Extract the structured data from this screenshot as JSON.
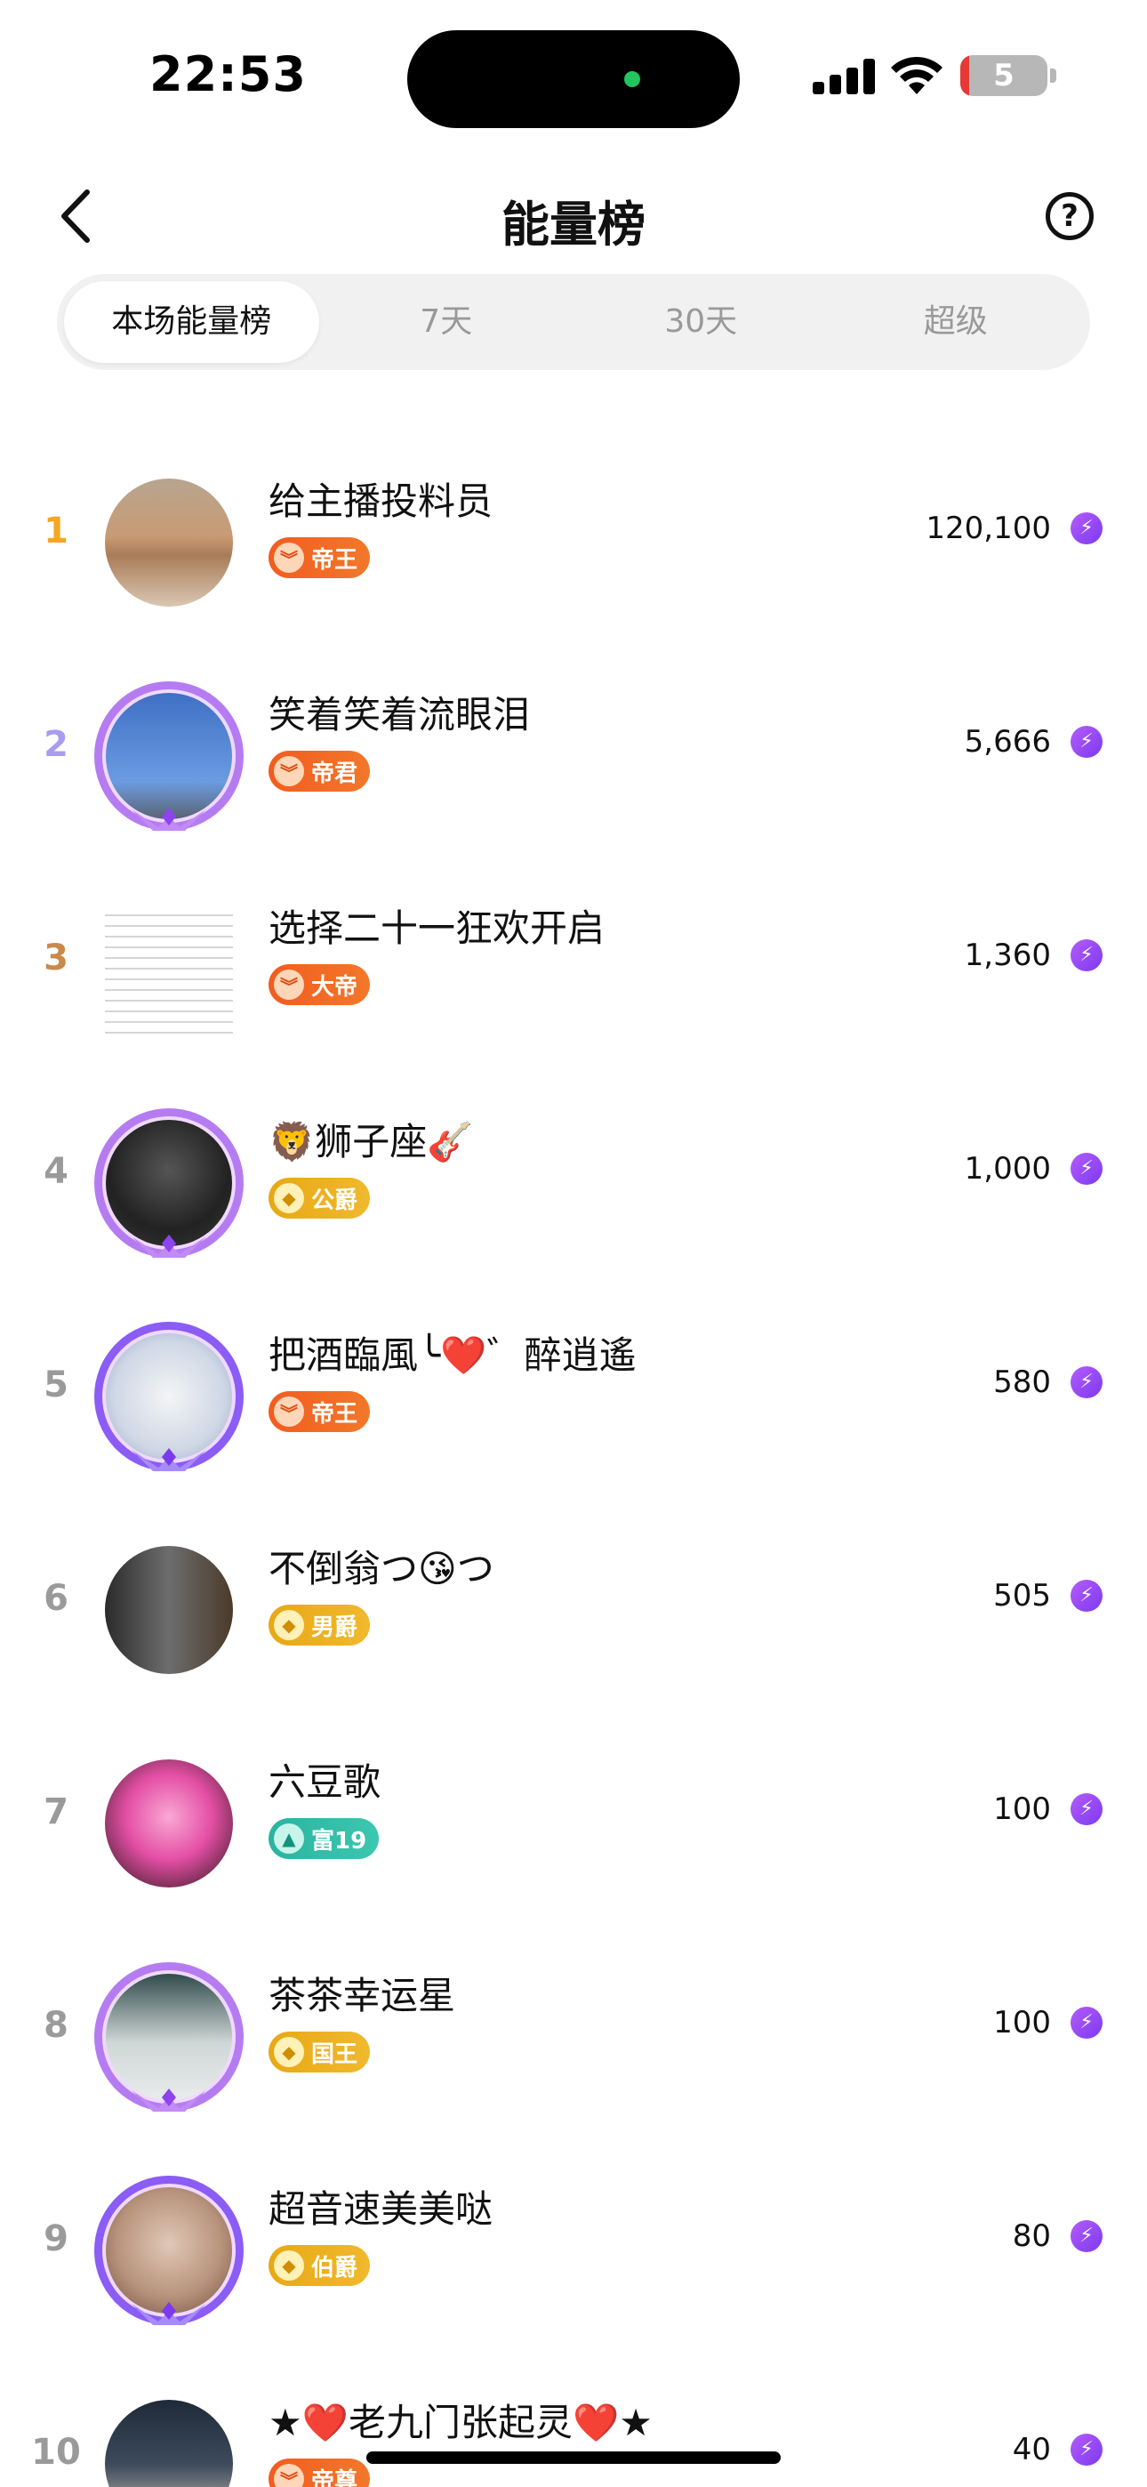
{
  "status_bar": {
    "time": "22:53",
    "battery": "5"
  },
  "header": {
    "title": "能量榜",
    "help_symbol": "?"
  },
  "tabs": [
    {
      "label": "本场能量榜",
      "active": true
    },
    {
      "label": "7天",
      "active": false
    },
    {
      "label": "30天",
      "active": false
    },
    {
      "label": "超级",
      "active": false
    }
  ],
  "rows": [
    {
      "rank": "1",
      "name": "给主播投料员",
      "badge": "帝王",
      "badge_icon": "crown-chevron-icon",
      "score": "120,100"
    },
    {
      "rank": "2",
      "name": "笑着笑着流眼泪",
      "badge": "帝君",
      "badge_icon": "crown-chevron-icon",
      "score": "5,666"
    },
    {
      "rank": "3",
      "name": "选择二十一狂欢开启",
      "badge": "大帝",
      "badge_icon": "crown-chevron-icon",
      "score": "1,360"
    },
    {
      "rank": "4",
      "name": "🦁狮子座🎸",
      "badge": "公爵",
      "badge_icon": "diamond-icon",
      "score": "1,000"
    },
    {
      "rank": "5",
      "name": "把酒臨風╰❤️゛醉逍遙",
      "badge": "帝王",
      "badge_icon": "crown-chevron-icon",
      "score": "580"
    },
    {
      "rank": "6",
      "name": "不倒翁つ😘つ",
      "badge": "男爵",
      "badge_icon": "diamond-icon",
      "score": "505"
    },
    {
      "rank": "7",
      "name": "六豆歌",
      "badge": "富19",
      "badge_icon": "triangle-icon",
      "score": "100"
    },
    {
      "rank": "8",
      "name": "茶茶幸运星",
      "badge": "国王",
      "badge_icon": "diamond-icon",
      "score": "100"
    },
    {
      "rank": "9",
      "name": "超音速美美哒",
      "badge": "伯爵",
      "badge_icon": "diamond-icon",
      "score": "80"
    },
    {
      "rank": "10",
      "name": "★❤️老九门张起灵❤️★",
      "badge": "帝尊",
      "badge_icon": "crown-chevron-icon",
      "score": "40"
    }
  ],
  "colors": {
    "rank1": "#f5a623",
    "rank2": "#a99cf0",
    "rank3": "#c98a4b",
    "badge_orange": "#f25c1f",
    "badge_gold": "#e8a815",
    "badge_teal": "#2bb3a0",
    "energy": "#8b3cf0"
  }
}
